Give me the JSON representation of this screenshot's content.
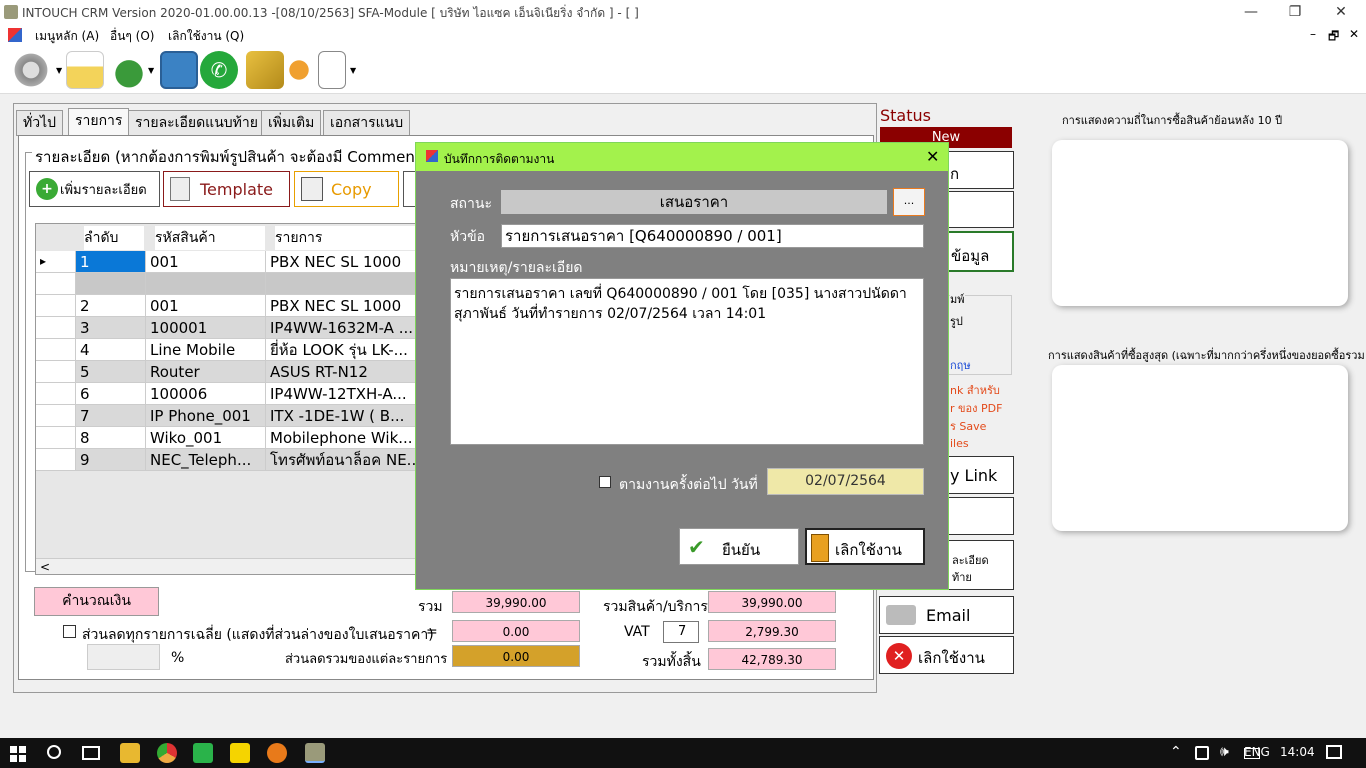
{
  "window": {
    "title": "INTOUCH CRM Version 2020-01.00.00.13 -[08/10/2563] SFA-Module  [ บริษัท ไอแซค เอ็นจิเนียริ่ง จำกัด ] - [ ]",
    "min": "—",
    "max": "❐",
    "close": "✕"
  },
  "menu": {
    "main": "เมนูหลัก (A)",
    "other": "อื่นๆ (O)",
    "exit": "เลิกใช้งาน (Q)",
    "restore": "🗗",
    "close": "✕",
    "minus": "–"
  },
  "tabs": [
    "ทั่วไป",
    "รายการ",
    "รายละเอียดแนบท้าย",
    "เพิ่มเติม",
    "เอกสารแนบ"
  ],
  "detail": {
    "group_title": "รายละเอียด (หากต้องการพิมพ์รูปสินค้า จะต้องมี Comment ต่อจ",
    "add_btn": "เพิ่มรายละเอียด",
    "template_btn": "Template",
    "copy_btn": "Copy"
  },
  "grid": {
    "headers": [
      "ลำดับ",
      "รหัสสินค้า",
      "รายการ"
    ],
    "rows": [
      [
        "1",
        "001",
        "PBX NEC SL 1000"
      ],
      [
        "",
        "",
        ""
      ],
      [
        "2",
        "001",
        "PBX NEC SL 1000"
      ],
      [
        "3",
        "100001",
        "IP4WW-1632M-A ..."
      ],
      [
        "4",
        "Line Mobile",
        "ยี่ห้อ LOOK รุ่น LK-..."
      ],
      [
        "5",
        "Router",
        "ASUS RT-N12"
      ],
      [
        "6",
        "100006",
        "IP4WW-12TXH-A..."
      ],
      [
        "7",
        "IP Phone_001",
        "ITX -1DE-1W ( B..."
      ],
      [
        "8",
        "Wiko_001",
        "Mobilephone Wik..."
      ],
      [
        "9",
        "NEC_Teleph...",
        "โทรศัพท์อนาล็อค NE..."
      ]
    ],
    "row_marker": "▸",
    "scroll_left": "<"
  },
  "totals": {
    "calc_btn": "คำนวณเงิน",
    "sum_label": "รวม",
    "sum_value": "39,990.00",
    "avg_discount_label": "ส่วนลดทุกรายการเฉลี่ย (แสดงที่ส่วนล่างของใบเสนอราคา)",
    "equals": "=",
    "avg_discount_value": "0.00",
    "percent": "%",
    "item_discount_label": "ส่วนลดรวมของแต่ละรายการ",
    "item_discount_value": "0.00",
    "goods_label": "รวมสินค้า/บริการ",
    "goods_value": "39,990.00",
    "vat_label": "VAT",
    "vat_rate": "7",
    "vat_value": "2,799.30",
    "grand_label": "รวมทั้งสิ้น",
    "grand_value": "42,789.30"
  },
  "status": {
    "heading": "Status",
    "badge": "New",
    "btn1": "ก",
    "btn3": "ข้อมูล",
    "print_title": "มพ์",
    "print_opt": "รูป",
    "print_lang": "กฤษ",
    "note1": "nk สำหรับ",
    "note2": "r ของ PDF",
    "note3": "ร Save",
    "note4": "iles",
    "copylink": "y Link",
    "attach_line1": "ละเอียด",
    "attach_line2": "ท้าย",
    "email": "Email",
    "exit": "เลิกใช้งาน"
  },
  "right": {
    "chart1_title": "การแสดงความถี่ในการซื้อสินค้าย้อนหลัง 10 ปี",
    "chart2_title": "การแสดงสินค้าที่ซื้อสูงสุด (เฉพาะที่มากกว่าครึ่งหนึ่งของยอดซื้อรวม"
  },
  "dialog": {
    "title": "บันทึกการติดตามงาน",
    "close": "✕",
    "status_label": "สถานะ",
    "status_value": "เสนอราคา",
    "status_btn": "...",
    "subject_label": "หัวข้อ",
    "subject_value": "รายการเสนอราคา [Q640000890 / 001]",
    "note_label": "หมายเหตุ/รายละเอียด",
    "note_value": "รายการเสนอราคา เลขที่  Q640000890 / 001 โดย [035] นางสาวปนัดดา สุภาพันธ์ วันที่ทำรายการ 02/07/2564 เวลา 14:01",
    "followup_label": "ตามงานครั้งต่อไป วันที่",
    "followup_date": "02/07/2564",
    "confirm": "ยืนยัน",
    "cancel": "เลิกใช้งาน"
  },
  "taskbar": {
    "lang": "ENG",
    "time": "14:04",
    "up": "⌃"
  },
  "colors": {
    "dialog_title": "#a3f24c",
    "status_badge": "#8b0000",
    "pink": "#ffc8d7",
    "gold": "#d4a12a"
  }
}
